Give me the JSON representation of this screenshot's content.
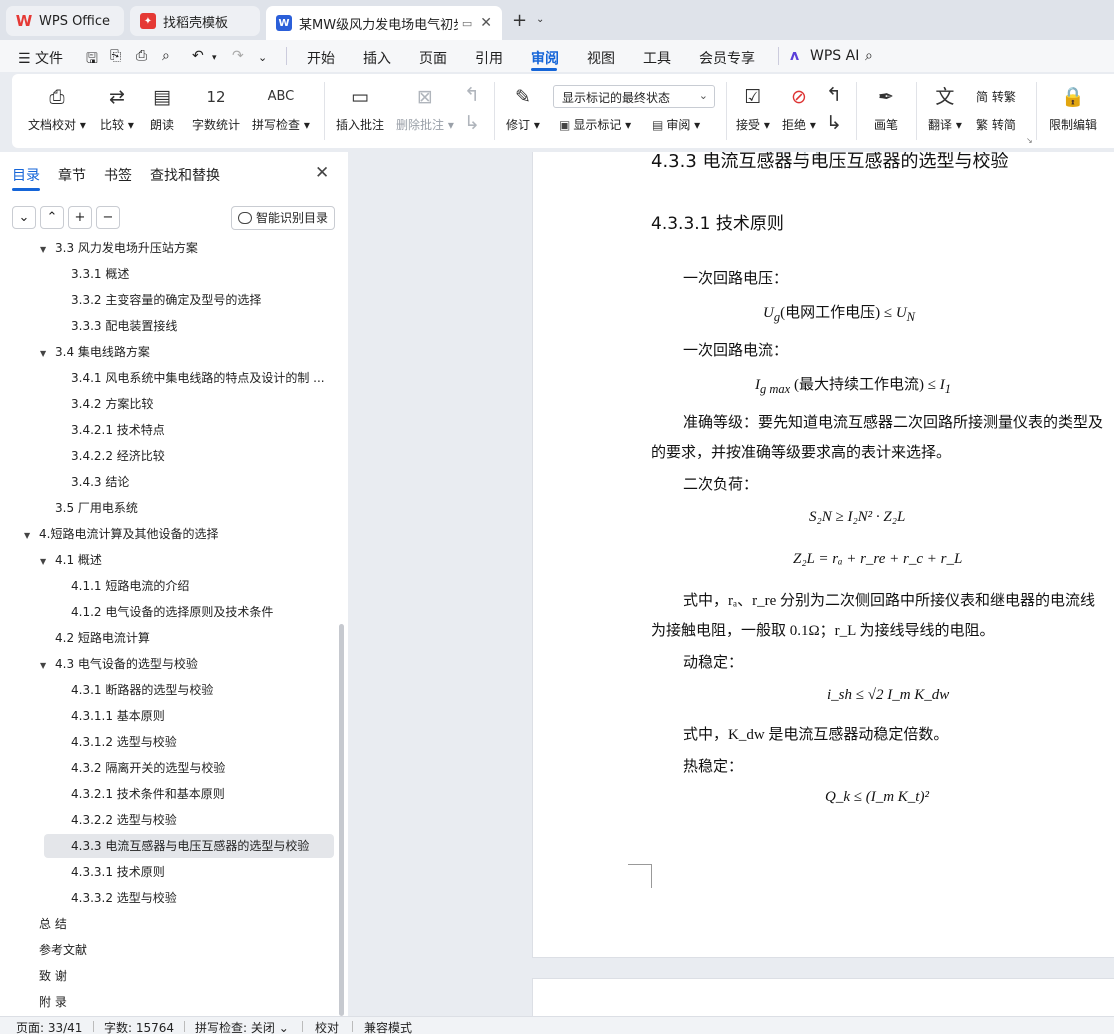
{
  "tabs": [
    {
      "label": "WPS Office",
      "icon": "wps-logo-icon"
    },
    {
      "label": "找稻壳模板",
      "icon": "docer-icon"
    },
    {
      "label": "某MW级风力发电场电气初步设计",
      "icon": "writer-doc-icon",
      "active": true
    }
  ],
  "menu": {
    "file": "文件",
    "items": [
      "开始",
      "插入",
      "页面",
      "引用",
      "审阅",
      "视图",
      "工具",
      "会员专享"
    ],
    "active": "审阅",
    "ai": "WPS AI"
  },
  "ribbon": {
    "doc_proof": "文档校对",
    "compare": "比较",
    "read_aloud": "朗读",
    "word_count": "字数统计",
    "spell_check": "拼写检查",
    "insert_comment": "插入批注",
    "delete_comment": "删除批注",
    "track_changes": "修订",
    "display_mode": "显示标记的最终状态",
    "show_markup": "显示标记",
    "review_pane": "审阅",
    "accept": "接受",
    "reject": "拒绝",
    "pen": "画笔",
    "translate": "翻译",
    "to_traditional": "简 转繁",
    "to_simplified": "繁 转简",
    "restrict_edit": "限制编辑"
  },
  "nav": {
    "tabs": [
      "目录",
      "章节",
      "书签",
      "查找和替换"
    ],
    "active_tab": "目录",
    "smart_toc": "智能识别目录",
    "toc": [
      {
        "label": "3.3  风力发电场升压站方案",
        "level": 2,
        "caret": true
      },
      {
        "label": "3.3.1  概述",
        "level": 3
      },
      {
        "label": "3.3.2  主变容量的确定及型号的选择",
        "level": 3
      },
      {
        "label": "3.3.3  配电装置接线",
        "level": 3
      },
      {
        "label": "3.4  集电线路方案",
        "level": 2,
        "caret": true
      },
      {
        "label": "3.4.1  风电系统中集电线路的特点及设计的制 ...",
        "level": 3
      },
      {
        "label": "3.4.2  方案比较",
        "level": 3
      },
      {
        "label": "3.4.2.1  技术特点",
        "level": 3
      },
      {
        "label": "3.4.2.2  经济比较",
        "level": 3
      },
      {
        "label": "3.4.3  结论",
        "level": 3
      },
      {
        "label": "3.5  厂用电系统",
        "level": 2
      },
      {
        "label": "4.短路电流计算及其他设备的选择",
        "level": 1,
        "caret": true
      },
      {
        "label": "4.1  概述",
        "level": 2,
        "caret": true
      },
      {
        "label": "4.1.1  短路电流的介绍",
        "level": 3
      },
      {
        "label": "4.1.2  电气设备的选择原则及技术条件",
        "level": 3
      },
      {
        "label": "4.2  短路电流计算",
        "level": 2
      },
      {
        "label": "4.3  电气设备的选型与校验",
        "level": 2,
        "caret": true
      },
      {
        "label": "4.3.1  断路器的选型与校验",
        "level": 3
      },
      {
        "label": "4.3.1.1  基本原则",
        "level": 3
      },
      {
        "label": "4.3.1.2  选型与校验",
        "level": 3
      },
      {
        "label": "4.3.2  隔离开关的选型与校验",
        "level": 3
      },
      {
        "label": "4.3.2.1  技术条件和基本原则",
        "level": 3
      },
      {
        "label": "4.3.2.2  选型与校验",
        "level": 3
      },
      {
        "label": "4.3.3  电流互感器与电压互感器的选型与校验",
        "level": 3,
        "selected": true
      },
      {
        "label": "4.3.3.1  技术原则",
        "level": 3
      },
      {
        "label": "4.3.3.2  选型与校验",
        "level": 3
      },
      {
        "label": "总    结",
        "level": 1
      },
      {
        "label": "参考文献",
        "level": 1
      },
      {
        "label": "致    谢",
        "level": 1
      },
      {
        "label": "附    录",
        "level": 1
      }
    ]
  },
  "doc": {
    "heading_marker": "H3",
    "h3": "4.3.3  电流互感器与电压互感器的选型与校验",
    "h4": "4.3.3.1  技术原则",
    "p_voltage": "一次回路电压：",
    "f1_lhs": "U",
    "f1_sub": "g",
    "f1_text": "(电网工作电压) ≤ ",
    "f1_rhs": "U",
    "f1_rsub": "N",
    "p_current": "一次回路电流：",
    "f2_lhs": "I",
    "f2_sub": "g max",
    "f2_text": " (最大持续工作电流) ≤ ",
    "f2_rhs": "I",
    "f2_rsub": "1",
    "p_accuracy_1": "准确等级：要先知道电流互感器二次回路所接测量仪表的类型及",
    "p_accuracy_2": "的要求，并按准确等级要求高的表计来选择。",
    "p_load": "二次负荷：",
    "f3": "S₂N ≥ I₂N² · Z₂L",
    "f4": "Z₂L = rₐ + r_re + r_c + r_L",
    "p_where_1": "式中，rₐ、r_re 分别为二次侧回路中所接仪表和继电器的电流线",
    "p_where_2": "为接触电阻，一般取 0.1Ω；r_L 为接线导线的电阻。",
    "p_dynamic": "动稳定：",
    "f5": "i_sh ≤ √2 I_m K_dw",
    "p_kdw": "式中，K_dw 是电流互感器动稳定倍数。",
    "p_thermal": "热稳定：",
    "f6": "Q_k ≤ (I_m K_t)²"
  },
  "status": {
    "page": "页面: 33/41",
    "words": "字数: 15764",
    "spell": "拼写检查: 关闭",
    "proof": "校对",
    "compat": "兼容模式"
  }
}
